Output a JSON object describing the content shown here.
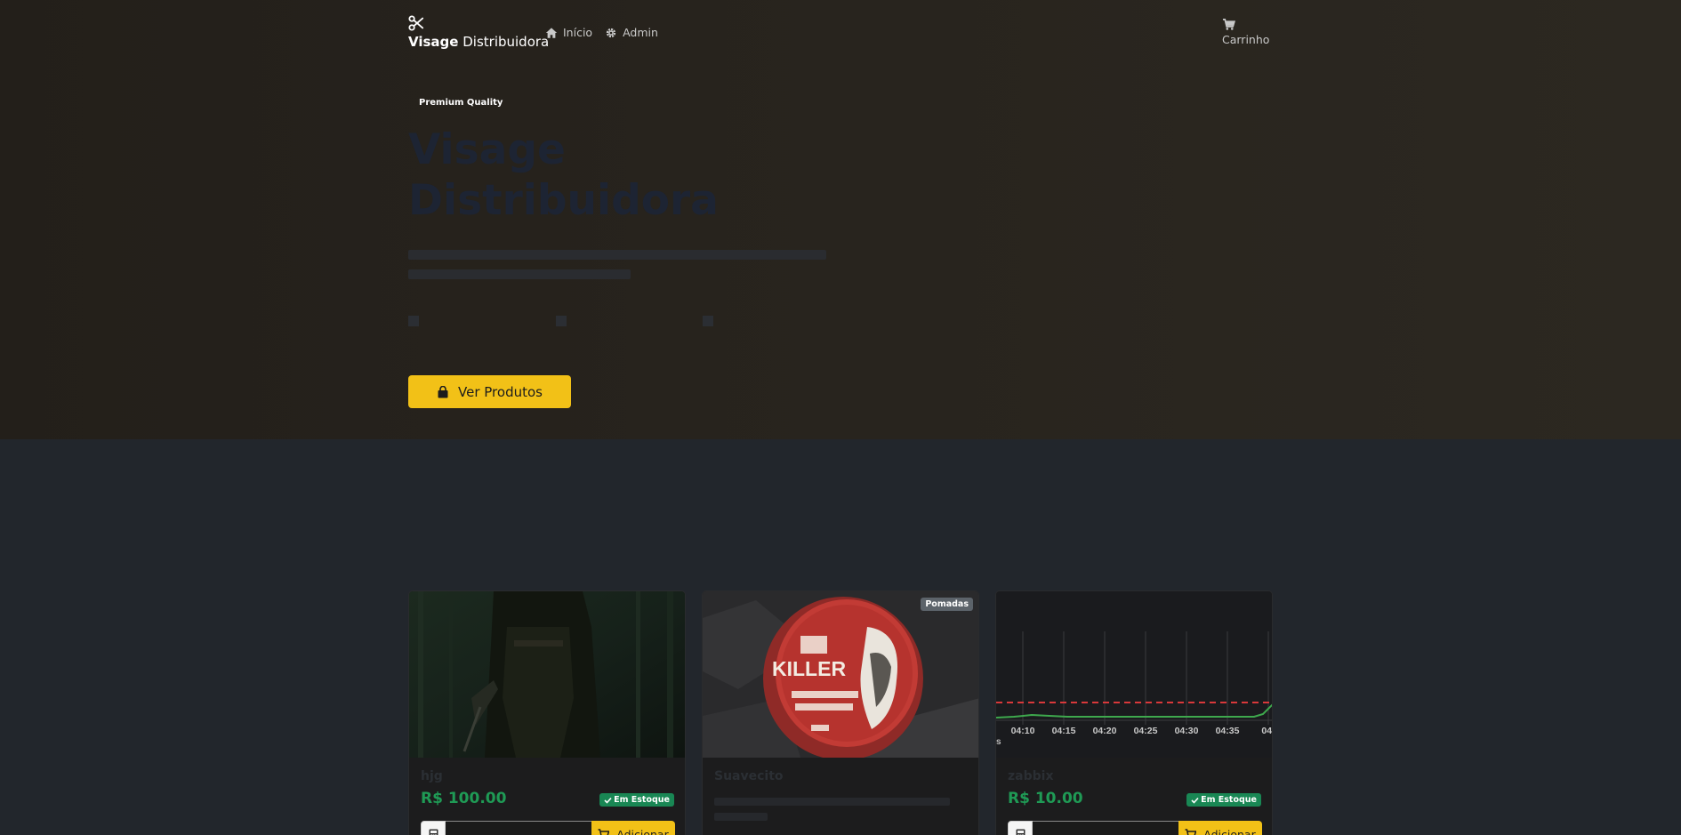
{
  "navbar": {
    "brand_bold": "Visage",
    "brand_rest": "Distribuidora",
    "links": [
      {
        "label": "Início",
        "icon": "home-icon"
      },
      {
        "label": "Admin",
        "icon": "gear-icon"
      }
    ],
    "cart_label": "Carrinho"
  },
  "hero": {
    "badge": "Premium Quality",
    "title_line1": "Visage",
    "title_line2": "Distribuidora",
    "cta_label": "Ver Produtos"
  },
  "products": [
    {
      "name": "hjg",
      "price": "R$ 100.00",
      "stock": "Em Estoque",
      "add_label": "Adicionar"
    },
    {
      "name": "Suavecito",
      "category": "Pomadas",
      "image_text": "KILLER"
    },
    {
      "name": "zabbix",
      "price": "R$ 10.00",
      "stock": "Em Estoque",
      "add_label": "Adicionar",
      "chart_ticks": [
        "04:10",
        "04:15",
        "04:20",
        "04:25",
        "04:30",
        "04:35",
        "04:"
      ]
    }
  ],
  "colors": {
    "accent": "#f2c117",
    "success": "#198754",
    "price": "#1f9a55",
    "page_bg": "#22262c"
  }
}
